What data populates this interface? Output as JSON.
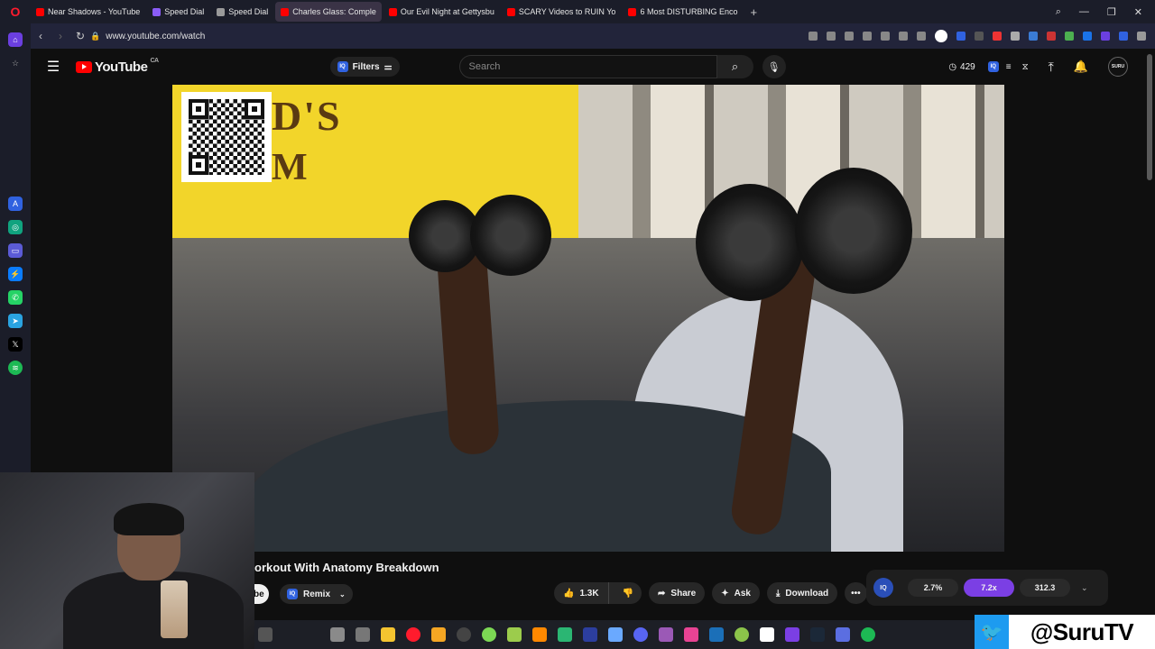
{
  "browser": {
    "tabs": [
      {
        "label": "Near Shadows - YouTube",
        "color": "#ff0000",
        "active": false
      },
      {
        "label": "Speed Dial",
        "color": "#8a5cf6",
        "active": false
      },
      {
        "label": "Speed Dial",
        "color": "#9a9a9a",
        "active": false
      },
      {
        "label": "Charles Glass: Comple",
        "color": "#ff0000",
        "active": true
      },
      {
        "label": "Our Evil Night at Gettysbu",
        "color": "#ff0000",
        "active": false
      },
      {
        "label": "SCARY Videos to RUIN Yo",
        "color": "#ff0000",
        "active": false
      },
      {
        "label": "6 Most DISTURBING Enco",
        "color": "#ff0000",
        "active": false
      }
    ],
    "new_tab": "+",
    "url": "www.youtube.com/watch"
  },
  "youtube": {
    "logo_text": "YouTube",
    "region": "CA",
    "filters_label": "Filters",
    "iq_badge": "IQ",
    "search_placeholder": "Search",
    "watch_count": "429",
    "avatar_text": "SURU"
  },
  "video": {
    "sign_line1": "D'S",
    "sign_line2": "M",
    "title": "orkout With Anatomy Breakdown",
    "subscribe_partial": "be",
    "remix_label": "Remix",
    "like_count": "1.3K",
    "share_label": "Share",
    "ask_label": "Ask",
    "download_label": "Download",
    "more_label": "•••"
  },
  "iq_panel": {
    "badge": "IQ",
    "stat1": "2.7%",
    "stat2": "7.2x",
    "stat3": "312.3"
  },
  "overlay": {
    "handle": "@SuruTV"
  },
  "colors": {
    "yt_red": "#ff0000",
    "accent_purple": "#7b3fe4",
    "twitter_blue": "#1d9bf0"
  }
}
